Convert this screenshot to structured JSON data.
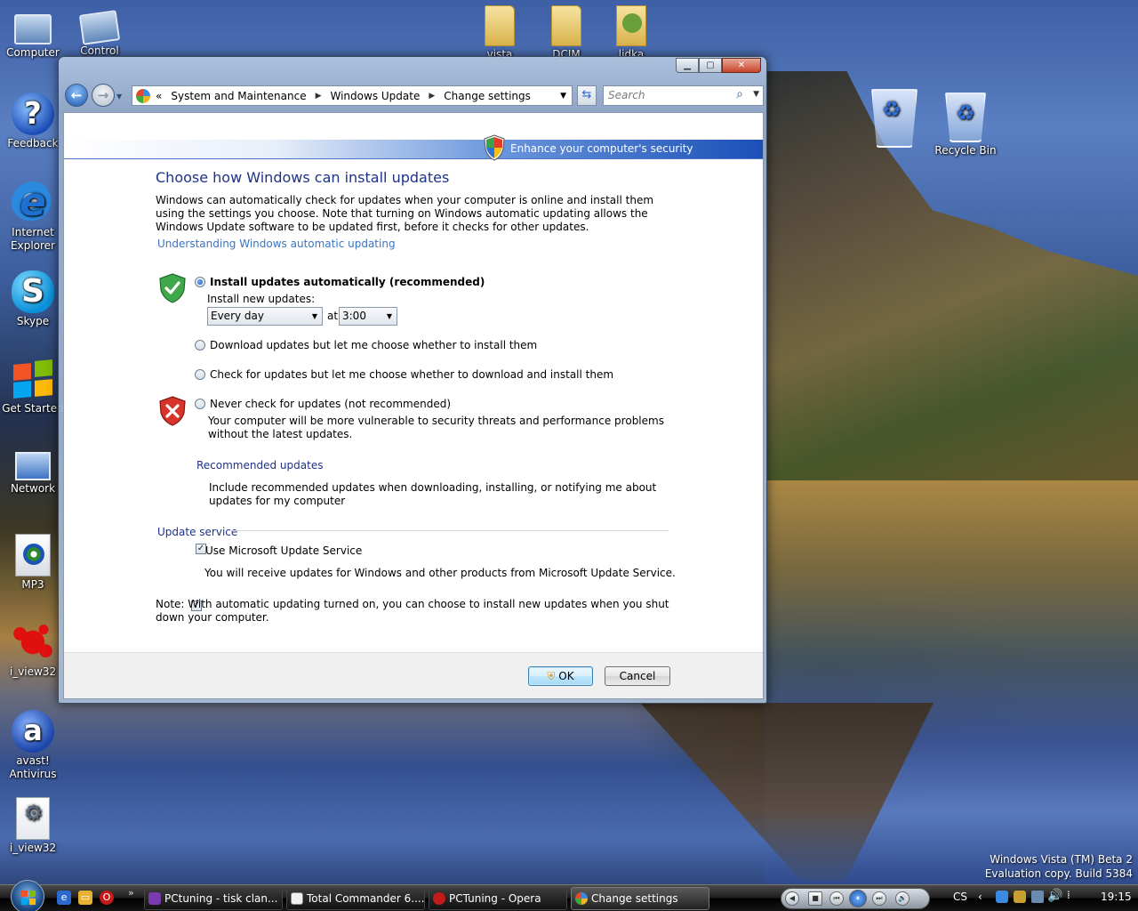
{
  "desktop": {
    "icons_left": [
      {
        "label": "Computer"
      },
      {
        "label": "Feedback"
      },
      {
        "label": "Internet Explorer"
      },
      {
        "label": "Skype"
      },
      {
        "label": "Get Started"
      },
      {
        "label": "Network"
      },
      {
        "label": "MP3"
      },
      {
        "label": "i_view32"
      },
      {
        "label": "avast! Antivirus"
      },
      {
        "label": "i_view32"
      }
    ],
    "icons_top": [
      {
        "label": "Control"
      },
      {
        "label": "vista"
      },
      {
        "label": "DCIM"
      },
      {
        "label": "lidka"
      }
    ],
    "recycle_bin_empty_label": "",
    "recycle_bin_label": "Recycle Bin"
  },
  "window": {
    "caption_buttons": {
      "minimize": "▁",
      "maximize": "▢",
      "close": "✕"
    },
    "address": {
      "chevron": "«",
      "crumbs": [
        "System and Maintenance",
        "Windows Update",
        "Change settings"
      ]
    },
    "search_placeholder": "Search",
    "banner": "Enhance your computer's security",
    "title": "Choose how Windows can install updates",
    "intro": "Windows can automatically check for updates when your computer is online and install them using the settings you choose. Note that turning on Windows automatic updating allows the Windows Update software to be updated first, before it checks for other updates.",
    "link_understanding": "Understanding Windows automatic updating",
    "options": {
      "auto": "Install updates automatically (recommended)",
      "install_new_label": "Install new updates:",
      "frequency": "Every day",
      "at_label": "at",
      "time": "3:00",
      "download": "Download updates but let me choose whether to install them",
      "check": "Check for updates but let me choose whether to download and install them",
      "never": "Never check for updates (not recommended)",
      "never_note": "Your computer will be more vulnerable to security threats and performance problems without the latest updates."
    },
    "selected_option": "auto",
    "recommended": {
      "heading": "Recommended updates",
      "checkbox_label": "Include recommended updates when downloading, installing, or notifying me about updates for my computer",
      "checked": true
    },
    "update_service": {
      "heading": "Update service",
      "checkbox_label": "Use Microsoft Update Service",
      "checked": true,
      "note": "You will receive updates for Windows and other products from Microsoft Update Service."
    },
    "note": "Note: With automatic updating turned on, you can choose to install new updates when you shut down your computer.",
    "ok_label": "OK",
    "cancel_label": "Cancel"
  },
  "taskbar": {
    "more": "»",
    "tasks": [
      {
        "label": "PCtuning - tisk clan..."
      },
      {
        "label": "Total Commander 6...."
      },
      {
        "label": "PCTuning - Opera"
      },
      {
        "label": "Change settings"
      }
    ],
    "media_buttons": [
      "◀",
      "■",
      "⏮",
      "⏸",
      "⏭",
      "🔊"
    ],
    "lang": "CS",
    "tray_arrow": "‹",
    "clock": "19:15"
  },
  "watermark": {
    "line1": "Windows Vista (TM) Beta 2",
    "line2": "Evaluation copy. Build 5384"
  }
}
